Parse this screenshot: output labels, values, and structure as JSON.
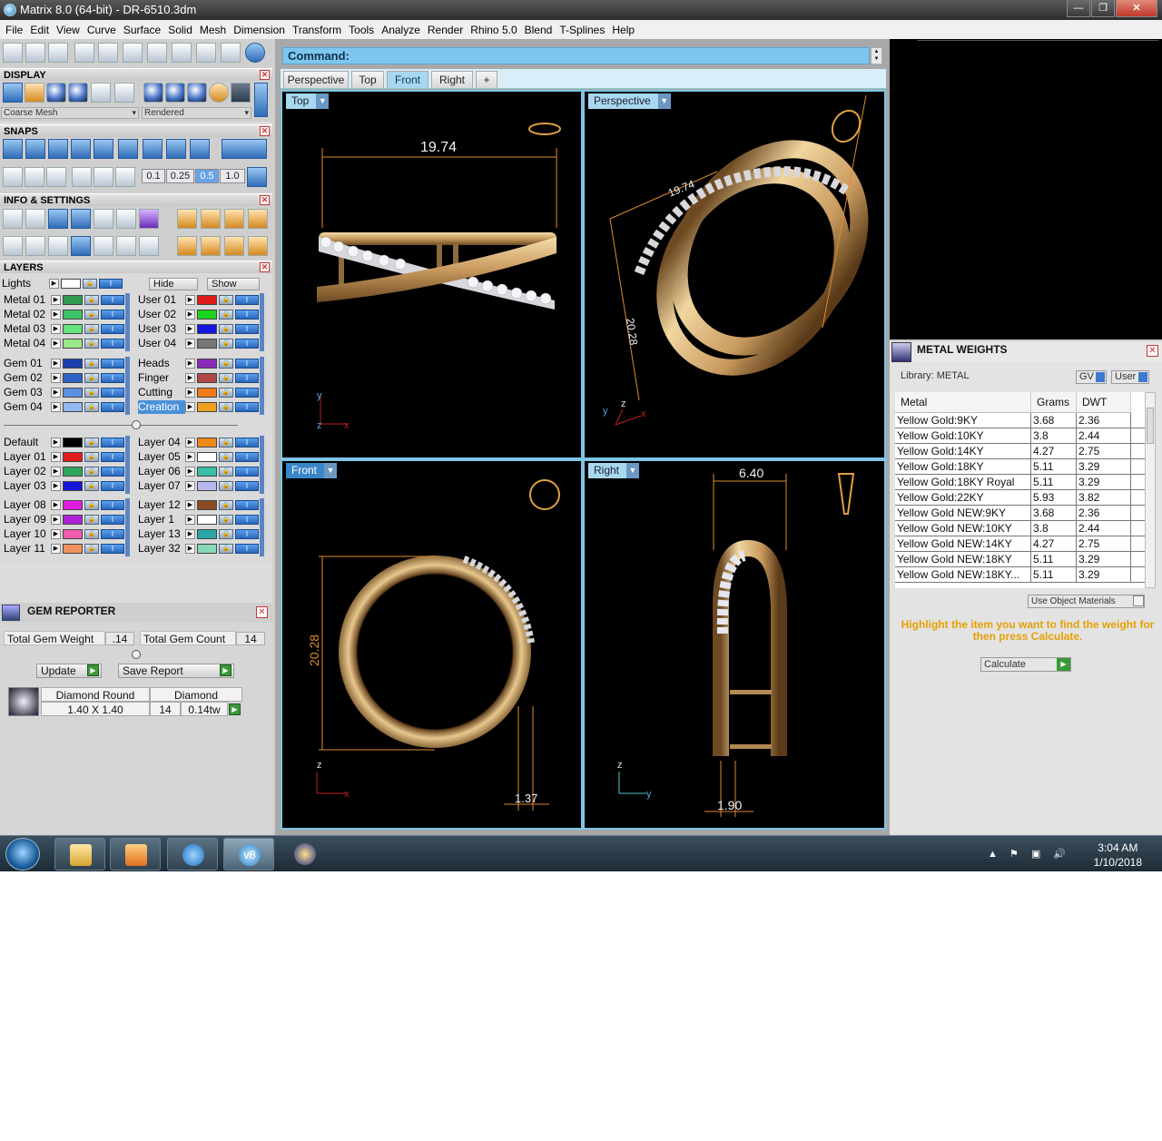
{
  "window": {
    "title": "Matrix 8.0 (64-bit) - DR-6510.3dm",
    "min": "—",
    "max": "❐",
    "close": "✕"
  },
  "menu": [
    "File",
    "Edit",
    "View",
    "Curve",
    "Surface",
    "Solid",
    "Mesh",
    "Dimension",
    "Transform",
    "Tools",
    "Analyze",
    "Render",
    "Rhino 5.0",
    "Blend",
    "T-Splines",
    "Help"
  ],
  "panels": {
    "display": "DISPLAY",
    "display_mesh": "Coarse Mesh",
    "display_mode": "Rendered",
    "snaps": "SNAPS",
    "snap_values": [
      "0.1",
      "0.25",
      "0.5",
      "1.0"
    ],
    "info": "INFO & SETTINGS",
    "layers": "LAYERS",
    "close": "✕"
  },
  "layers": {
    "lights": "Lights",
    "hide": "Hide",
    "show": "Show",
    "left_group1": [
      {
        "name": "Metal 01",
        "color": "#2e9a52"
      },
      {
        "name": "Metal 02",
        "color": "#3cc466"
      },
      {
        "name": "Metal 03",
        "color": "#66e27e"
      },
      {
        "name": "Metal 04",
        "color": "#9be88a"
      }
    ],
    "right_group1": [
      {
        "name": "User 01",
        "color": "#e01b1b"
      },
      {
        "name": "User 02",
        "color": "#1bd41b"
      },
      {
        "name": "User 03",
        "color": "#1616e0"
      },
      {
        "name": "User 04",
        "color": "#777777"
      }
    ],
    "left_group2": [
      {
        "name": "Gem 01",
        "color": "#1a3fae"
      },
      {
        "name": "Gem 02",
        "color": "#2f62c8"
      },
      {
        "name": "Gem 03",
        "color": "#5a8fe2"
      },
      {
        "name": "Gem 04",
        "color": "#93b8ee"
      }
    ],
    "right_group2": [
      {
        "name": "Heads",
        "color": "#8a2bb8"
      },
      {
        "name": "Finger",
        "color": "#b04646"
      },
      {
        "name": "Cutting",
        "color": "#f07a18"
      },
      {
        "name": "Creation",
        "color": "#f0a020"
      }
    ],
    "left_group3": [
      {
        "name": "Default",
        "color": "#000000"
      },
      {
        "name": "Layer 01",
        "color": "#e01b1b"
      },
      {
        "name": "Layer 02",
        "color": "#2ea65a"
      },
      {
        "name": "Layer 03",
        "color": "#1616d8"
      }
    ],
    "right_group3": [
      {
        "name": "Layer 04",
        "color": "#f08818"
      },
      {
        "name": "Layer 05",
        "color": "#ffffff"
      },
      {
        "name": "Layer 06",
        "color": "#38bfa8"
      },
      {
        "name": "Layer 07",
        "color": "#b8b8f0"
      }
    ],
    "left_group4": [
      {
        "name": "Layer 08",
        "color": "#e01be0"
      },
      {
        "name": "Layer 09",
        "color": "#b020d8"
      },
      {
        "name": "Layer 10",
        "color": "#f05cb0"
      },
      {
        "name": "Layer 11",
        "color": "#f09060"
      }
    ],
    "right_group4": [
      {
        "name": "Layer 12",
        "color": "#8a4a22"
      },
      {
        "name": "Layer 1",
        "color": "#ffffff"
      },
      {
        "name": "Layer 13",
        "color": "#2aa6a6"
      },
      {
        "name": "Layer 32",
        "color": "#88d8b8"
      }
    ]
  },
  "gem_reporter": {
    "title": "GEM REPORTER",
    "weight_label": "Total Gem Weight",
    "weight_value": ".14",
    "count_label": "Total Gem Count",
    "count_value": "14",
    "update": "Update",
    "save_report": "Save Report",
    "headers": [
      "Diamond Round",
      "Diamond"
    ],
    "size": "1.40 X 1.40",
    "qty": "14",
    "tw": "0.14tw"
  },
  "command": {
    "label": "Command:"
  },
  "view_tabs": [
    "Perspective",
    "Top",
    "Front",
    "Right",
    "+"
  ],
  "viewports": {
    "top": {
      "label": "Top",
      "dim": "19.74"
    },
    "perspective": {
      "label": "Perspective",
      "dim_a": "19.74",
      "dim_b": "20.28"
    },
    "front": {
      "label": "Front",
      "dim_a": "20.28",
      "dim_b": "1.37"
    },
    "right": {
      "label": "Right",
      "dim_a": "6.40",
      "dim_b": "1.90"
    },
    "axis_x": "x",
    "axis_y": "y",
    "axis_z": "z"
  },
  "metal_weights": {
    "title": "METAL WEIGHTS",
    "library": "Library: METAL",
    "gv": "GV",
    "user": "User",
    "columns": [
      "Metal",
      "Grams",
      "DWT"
    ],
    "rows": [
      [
        "Yellow Gold:9KY",
        "3.68",
        "2.36"
      ],
      [
        "Yellow Gold:10KY",
        "3.8",
        "2.44"
      ],
      [
        "Yellow Gold:14KY",
        "4.27",
        "2.75"
      ],
      [
        "Yellow Gold:18KY",
        "5.11",
        "3.29"
      ],
      [
        "Yellow Gold:18KY Royal",
        "5.11",
        "3.29"
      ],
      [
        "Yellow Gold:22KY",
        "5.93",
        "3.82"
      ],
      [
        "Yellow Gold NEW:9KY",
        "3.68",
        "2.36"
      ],
      [
        "Yellow Gold NEW:10KY",
        "3.8",
        "2.44"
      ],
      [
        "Yellow Gold NEW:14KY",
        "4.27",
        "2.75"
      ],
      [
        "Yellow Gold NEW:18KY",
        "5.11",
        "3.29"
      ],
      [
        "Yellow Gold NEW:18KY...",
        "5.11",
        "3.29"
      ]
    ],
    "use_object": "Use Object Materials",
    "hint": "Highlight the item you want to find the weight for then press Calculate.",
    "calculate": "Calculate"
  },
  "taskbar": {
    "time": "3:04 AM",
    "date": "1/10/2018",
    "app_v8": "v8"
  }
}
